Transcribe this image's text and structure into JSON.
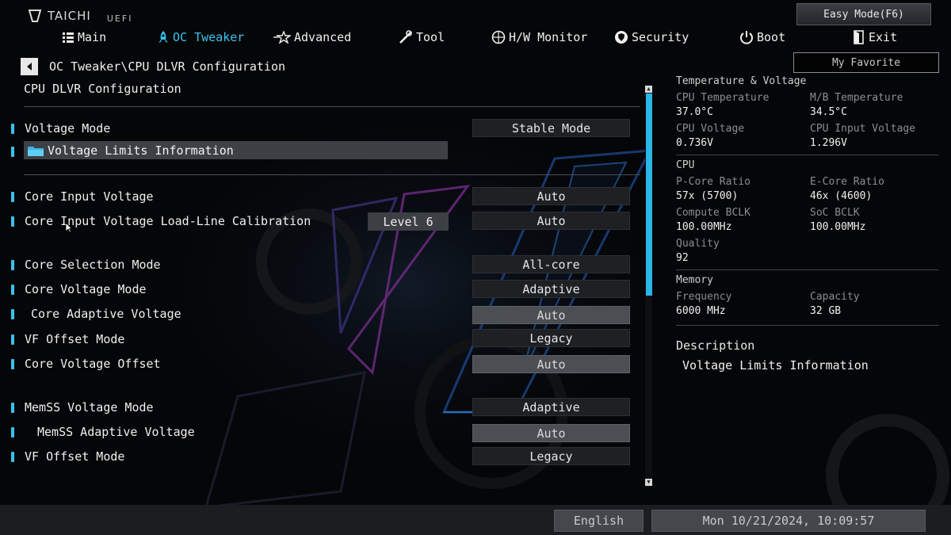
{
  "brand": {
    "name": "TAICHI",
    "sub": "UEFI"
  },
  "top_buttons": {
    "easy_mode": "Easy Mode(F6)",
    "my_favorite": "My Favorite"
  },
  "nav": [
    {
      "label": "Main",
      "icon": "menu-icon"
    },
    {
      "label": "OC Tweaker",
      "icon": "rocket-icon",
      "active": true
    },
    {
      "label": "Advanced",
      "icon": "star-icon"
    },
    {
      "label": "Tool",
      "icon": "tools-icon"
    },
    {
      "label": "H/W Monitor",
      "icon": "monitor-icon"
    },
    {
      "label": "Security",
      "icon": "shield-icon"
    },
    {
      "label": "Boot",
      "icon": "power-icon"
    },
    {
      "label": "Exit",
      "icon": "exit-icon"
    }
  ],
  "breadcrumb": "OC Tweaker\\CPU DLVR Configuration",
  "section_title": "CPU DLVR Configuration",
  "settings": [
    {
      "label": "Voltage Mode",
      "value": "Stable Mode"
    },
    {
      "label": "Voltage Limits Information"
    },
    {
      "label": "Core Input Voltage",
      "value": "Auto"
    },
    {
      "label": "Core Input Voltage Load-Line Calibration",
      "value": "Auto",
      "extra": "Level 6"
    },
    {
      "label": "Core Selection Mode",
      "value": "All-core"
    },
    {
      "label": "Core Voltage Mode",
      "value": "Adaptive"
    },
    {
      "label": "Core Adaptive Voltage",
      "value": "Auto"
    },
    {
      "label": "VF Offset Mode",
      "value": "Legacy"
    },
    {
      "label": "Core Voltage Offset",
      "value": "Auto"
    },
    {
      "label": "MemSS Voltage Mode",
      "value": "Adaptive"
    },
    {
      "label": "MemSS Adaptive Voltage",
      "value": "Auto"
    },
    {
      "label": "VF Offset Mode",
      "value": "Legacy"
    }
  ],
  "hw": {
    "temp_voltage": {
      "title": "Temperature & Voltage",
      "cpu_temp_label": "CPU Temperature",
      "cpu_temp": "37.0°C",
      "mb_temp_label": "M/B Temperature",
      "mb_temp": "34.5°C",
      "cpu_voltage_label": "CPU Voltage",
      "cpu_voltage": "0.736V",
      "cpu_input_voltage_label": "CPU Input Voltage",
      "cpu_input_voltage": "1.296V"
    },
    "cpu": {
      "title": "CPU",
      "pcore_label": "P-Core Ratio",
      "pcore": "57x (5700)",
      "ecore_label": "E-Core Ratio",
      "ecore": "46x (4600)",
      "compute_bclk_label": "Compute BCLK",
      "compute_bclk": "100.00MHz",
      "soc_bclk_label": "SoC BCLK",
      "soc_bclk": "100.00MHz",
      "quality_label": "Quality",
      "quality": "92"
    },
    "memory": {
      "title": "Memory",
      "freq_label": "Frequency",
      "freq": "6000 MHz",
      "capacity_label": "Capacity",
      "capacity": "32 GB"
    }
  },
  "description": {
    "title": "Description",
    "text": "Voltage Limits Information"
  },
  "footer": {
    "language": "English",
    "datetime": "Mon 10/21/2024, 10:09:57"
  },
  "colors": {
    "accent": "#37c6f0",
    "background": "#050608",
    "footer": "#1b1d20"
  }
}
